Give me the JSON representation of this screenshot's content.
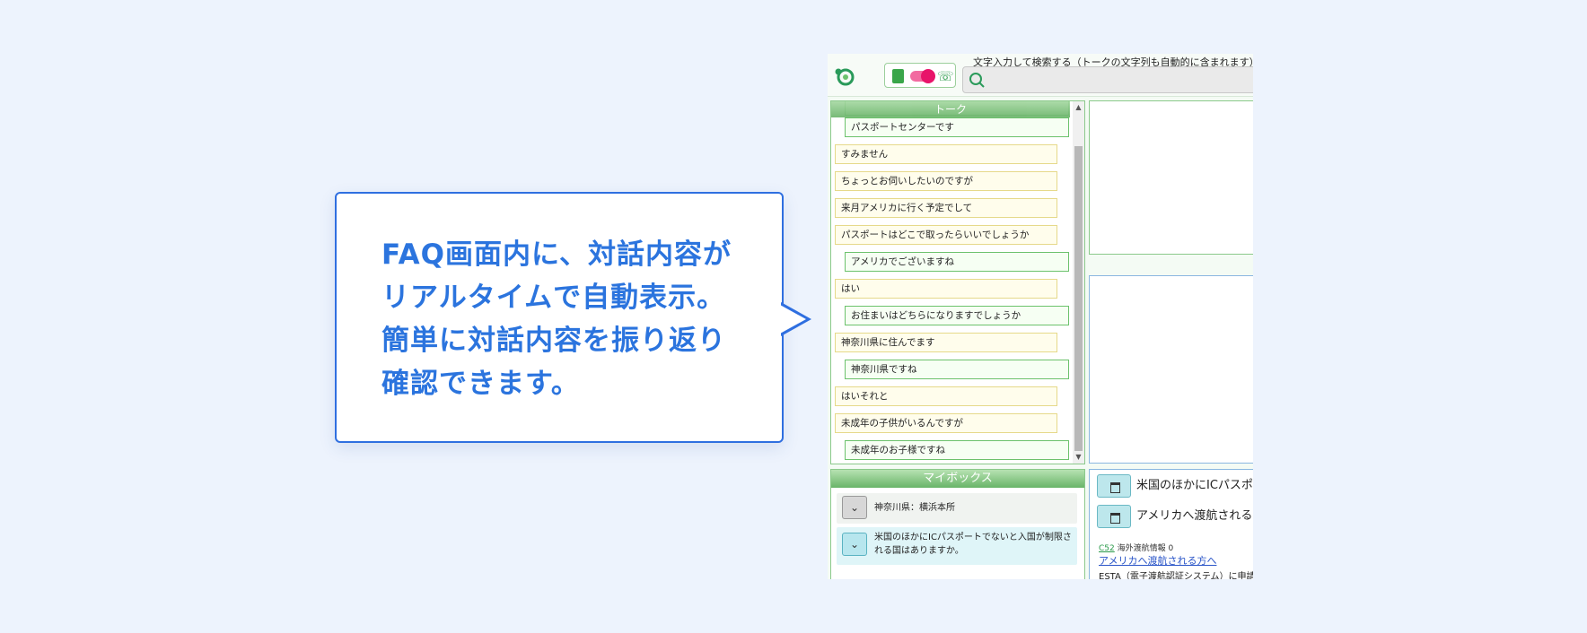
{
  "callout": {
    "lines": [
      "FAQ画面内に、対話内容が",
      "リアルタイムで自動表示。",
      "簡単に対話内容を振り返り",
      "確認できます。"
    ]
  },
  "app": {
    "search": {
      "label": "文字入力して検索する（トークの文字列も自動的に含まれます）"
    },
    "talk": {
      "title": "トーク",
      "messages": [
        {
          "speaker": "operator",
          "text": "パスポートセンターです"
        },
        {
          "speaker": "customer",
          "text": "すみません"
        },
        {
          "speaker": "customer",
          "text": "ちょっとお伺いしたいのですが"
        },
        {
          "speaker": "customer",
          "text": "来月アメリカに行く予定でして"
        },
        {
          "speaker": "customer",
          "text": "パスポートはどこで取ったらいいでしょうか"
        },
        {
          "speaker": "operator",
          "text": "アメリカでございますね"
        },
        {
          "speaker": "customer",
          "text": "はい"
        },
        {
          "speaker": "operator",
          "text": "お住まいはどちらになりますでしょうか"
        },
        {
          "speaker": "customer",
          "text": "神奈川県に住んでます"
        },
        {
          "speaker": "operator",
          "text": "神奈川県ですね"
        },
        {
          "speaker": "customer",
          "text": "はいそれと"
        },
        {
          "speaker": "customer",
          "text": "未成年の子供がいるんですが"
        },
        {
          "speaker": "operator",
          "text": "未成年のお子様ですね"
        }
      ]
    },
    "mybox": {
      "title": "マイボックス",
      "items": [
        "神奈川県：横浜本所",
        "米国のほかにICパスポートでないと入国が制限される国はありますか。"
      ]
    },
    "faq": {
      "items": [
        "米国のほかにICパスポ",
        "アメリカへ渡航される"
      ],
      "meta_id": "C52",
      "meta_category": "海外渡航情報",
      "meta_count": "0",
      "link": "アメリカへ渡航される方へ",
      "desc": "ESTA（電子渡航認証システム）に申請"
    }
  }
}
